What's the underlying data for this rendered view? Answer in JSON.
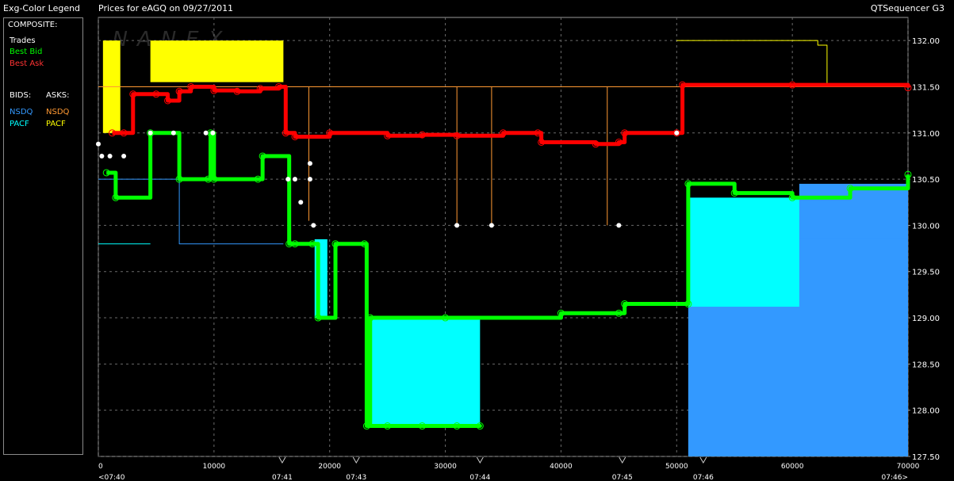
{
  "legend": {
    "title": "Exg-Color Legend",
    "composite_label": "COMPOSITE:",
    "trades": {
      "label": "Trades",
      "color": "#ffffff"
    },
    "best_bid": {
      "label": "Best Bid",
      "color": "#00ff00"
    },
    "best_ask": {
      "label": "Best Ask",
      "color": "#ff0000"
    },
    "bids_label": "BIDS:",
    "asks_label": "ASKS:",
    "bids": [
      {
        "label": "NSDQ",
        "color": "#3399ff"
      },
      {
        "label": "PACF",
        "color": "#00ffff"
      }
    ],
    "asks": [
      {
        "label": "NSDQ",
        "color": "#ff9933"
      },
      {
        "label": "PACF",
        "color": "#ffff00"
      }
    ]
  },
  "header": {
    "title": "Prices for  eAGQ  on  09/27/2011",
    "right_label": "QTSequencer G3",
    "watermark": "NANEX"
  },
  "chart_data": {
    "type": "line",
    "title": "Prices for  eAGQ  on  09/27/2011",
    "xlim": [
      0,
      70000
    ],
    "ylim": [
      127.5,
      132.25
    ],
    "grid": true,
    "legend_position": "left-panel",
    "x_ticks": [
      0,
      10000,
      20000,
      30000,
      40000,
      50000,
      60000,
      70000
    ],
    "x_tick_labels": [
      "0",
      "10000",
      "20000",
      "30000",
      "40000",
      "50000",
      "60000",
      "70000"
    ],
    "y_ticks": [
      127.5,
      128.0,
      128.5,
      129.0,
      129.5,
      130.0,
      130.5,
      131.0,
      131.5,
      132.0
    ],
    "y_tick_labels": [
      "127.50",
      "128.00",
      "128.50",
      "129.00",
      "129.50",
      "130.00",
      "130.50",
      "131.00",
      "131.50",
      "132.00"
    ],
    "time_marks": [
      {
        "x": 0,
        "label": "<07:40"
      },
      {
        "x": 15900,
        "label": "07:41"
      },
      {
        "x": 22300,
        "label": "07:43"
      },
      {
        "x": 33000,
        "label": "07:44"
      },
      {
        "x": 45300,
        "label": "07:45"
      },
      {
        "x": 52300,
        "label": "07:46"
      },
      {
        "x": 70000,
        "label": "07:46>"
      }
    ],
    "series": [
      {
        "name": "Best Ask",
        "color": "#ff0000",
        "points": [
          [
            1200,
            131.0
          ],
          [
            2200,
            131.0
          ],
          [
            3000,
            131.42
          ],
          [
            5000,
            131.42
          ],
          [
            6000,
            131.35
          ],
          [
            7000,
            131.45
          ],
          [
            8000,
            131.5
          ],
          [
            10000,
            131.46
          ],
          [
            12000,
            131.45
          ],
          [
            14000,
            131.48
          ],
          [
            15600,
            131.5
          ],
          [
            16200,
            131.0
          ],
          [
            17000,
            130.96
          ],
          [
            20000,
            131.0
          ],
          [
            25000,
            130.97
          ],
          [
            28000,
            130.98
          ],
          [
            31000,
            130.97
          ],
          [
            35000,
            131.0
          ],
          [
            38000,
            131.0
          ],
          [
            38300,
            130.9
          ],
          [
            43000,
            130.88
          ],
          [
            45000,
            130.9
          ],
          [
            45500,
            131.0
          ],
          [
            50000,
            131.0
          ],
          [
            50500,
            131.52
          ],
          [
            60000,
            131.52
          ],
          [
            70000,
            131.49
          ]
        ]
      },
      {
        "name": "Best Bid",
        "color": "#00ff00",
        "points": [
          [
            700,
            130.57
          ],
          [
            1500,
            130.3
          ],
          [
            4500,
            131.0
          ],
          [
            7000,
            130.5
          ],
          [
            9500,
            130.5
          ],
          [
            9700,
            131.0
          ],
          [
            10000,
            130.5
          ],
          [
            13800,
            130.5
          ],
          [
            14200,
            130.75
          ],
          [
            16500,
            129.8
          ],
          [
            17000,
            129.8
          ],
          [
            18500,
            129.8
          ],
          [
            19000,
            129.0
          ],
          [
            20500,
            129.8
          ],
          [
            23000,
            129.8
          ],
          [
            23200,
            127.83
          ],
          [
            25000,
            127.83
          ],
          [
            28000,
            127.83
          ],
          [
            31000,
            127.83
          ],
          [
            33000,
            127.83
          ],
          [
            23500,
            129.0
          ],
          [
            30000,
            129.0
          ],
          [
            40000,
            129.05
          ],
          [
            45000,
            129.05
          ],
          [
            45500,
            129.15
          ],
          [
            51000,
            129.15
          ],
          [
            51000,
            130.45
          ],
          [
            55000,
            130.35
          ],
          [
            60000,
            130.3
          ],
          [
            65000,
            130.4
          ],
          [
            70000,
            130.55
          ]
        ]
      },
      {
        "name": "PACF Bid",
        "color": "#00ffff",
        "fills": [
          [
            18700,
            19800,
            129.0,
            129.85
          ],
          [
            23200,
            33000,
            127.83,
            129.0
          ],
          [
            51000,
            60600,
            129.12,
            130.3
          ]
        ],
        "points": [
          [
            0,
            129.8
          ],
          [
            2000,
            129.8
          ],
          [
            4500,
            129.8
          ]
        ]
      },
      {
        "name": "NSDQ Bid",
        "color": "#3399ff",
        "fills": [
          [
            51000,
            70000,
            127.5,
            130.3
          ],
          [
            60600,
            70000,
            129.85,
            130.45
          ]
        ],
        "points": [
          [
            0,
            130.5
          ],
          [
            6800,
            130.5
          ],
          [
            7000,
            129.8
          ],
          [
            12000,
            129.8
          ],
          [
            16000,
            129.8
          ]
        ]
      },
      {
        "name": "PACF Ask",
        "color": "#ffff00",
        "fills": [
          [
            400,
            1900,
            131.0,
            132.0
          ],
          [
            4500,
            16000,
            131.55,
            132.0
          ]
        ],
        "points": [
          [
            50000,
            132.0
          ],
          [
            62000,
            132.0
          ],
          [
            62200,
            131.95
          ],
          [
            63000,
            131.95
          ],
          [
            63000,
            131.5
          ]
        ]
      },
      {
        "name": "NSDQ Ask",
        "color": "#ff9933",
        "points": [
          [
            0,
            131.5
          ],
          [
            70000,
            131.5
          ]
        ],
        "spikes": [
          [
            18200,
            130.05
          ],
          [
            31000,
            130.0
          ],
          [
            34000,
            130.0
          ],
          [
            44000,
            130.0
          ]
        ]
      },
      {
        "name": "Trades",
        "color": "#ffffff",
        "points": [
          [
            0,
            130.88
          ],
          [
            300,
            130.75
          ],
          [
            1000,
            130.75
          ],
          [
            2200,
            130.75
          ],
          [
            4500,
            131.0
          ],
          [
            6500,
            131.0
          ],
          [
            9300,
            131.0
          ],
          [
            9900,
            131.0
          ],
          [
            16400,
            130.5
          ],
          [
            17000,
            130.5
          ],
          [
            17500,
            130.25
          ],
          [
            18300,
            130.5
          ],
          [
            18300,
            130.67
          ],
          [
            18600,
            130.0
          ],
          [
            31000,
            130.0
          ],
          [
            34000,
            130.0
          ],
          [
            45000,
            130.0
          ],
          [
            50000,
            131.0
          ]
        ]
      }
    ]
  }
}
